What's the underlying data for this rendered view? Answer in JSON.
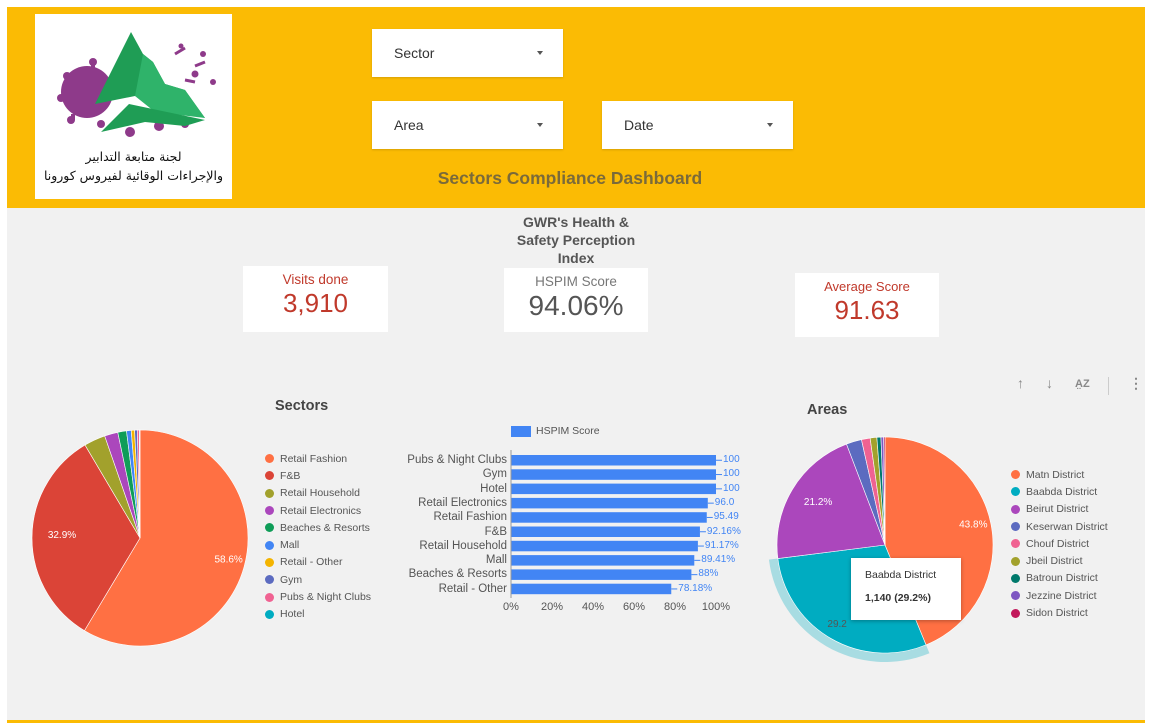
{
  "logo": {
    "line1": "لجنة متابعة التدابير",
    "line2": "والإجراءات الوقائية لفيروس كورونا"
  },
  "filters": {
    "sector": "Sector",
    "area": "Area",
    "date": "Date"
  },
  "dashboard_title": "Sectors Compliance Dashboard",
  "index_title_lines": [
    "GWR's Health &",
    "Safety Perception",
    "Index"
  ],
  "cards": {
    "visits": {
      "label": "Visits done",
      "value": "3,910"
    },
    "hspim": {
      "label": "HSPIM Score",
      "value": "94.06%"
    },
    "average": {
      "label": "Average Score",
      "value": "91.63"
    }
  },
  "colors": {
    "header": "#fbbb04",
    "card_red": "#c0392b",
    "bar": "#4285f4",
    "background": "#f1f1f1"
  },
  "chart_data": [
    {
      "type": "pie",
      "title": "Sectors",
      "labels": [
        "Retail Fashion",
        "F&B",
        "Retail Household",
        "Retail Electronics",
        "Beaches & Resorts",
        "Mall",
        "Retail - Other",
        "Gym",
        "Pubs & Night Clubs",
        "Hotel"
      ],
      "values": [
        58.6,
        32.9,
        3.2,
        2.0,
        1.3,
        0.7,
        0.5,
        0.4,
        0.3,
        0.1
      ],
      "value_labels": [
        "58.6%",
        "32.9%",
        "",
        "",
        "",
        "",
        "",
        "",
        "",
        ""
      ],
      "colors": [
        "#ff7043",
        "#db4437",
        "#a2a12c",
        "#ab47bc",
        "#0f9d58",
        "#4285f4",
        "#f4b400",
        "#5c6bc0",
        "#f06292",
        "#00acc1"
      ],
      "legend": "right"
    },
    {
      "type": "bar",
      "orientation": "horizontal",
      "series": [
        {
          "name": "HSPIM Score",
          "values": [
            100,
            100,
            100,
            96.0,
            95.49,
            92.16,
            91.17,
            89.41,
            88,
            78.18
          ]
        }
      ],
      "categories": [
        "Pubs & Night Clubs",
        "Gym",
        "Hotel",
        "Retail Electronics",
        "Retail Fashion",
        "F&B",
        "Retail Household",
        "Mall",
        "Beaches & Resorts",
        "Retail - Other"
      ],
      "value_labels": [
        "100",
        "100",
        "100",
        "96.0",
        "95.49",
        "92.16%",
        "91.17%",
        "89.41%",
        "88%",
        "78.18%"
      ],
      "x_ticks": [
        "0%",
        "20%",
        "40%",
        "60%",
        "80%",
        "100%"
      ],
      "xlim": [
        0,
        100
      ],
      "legend": "top"
    },
    {
      "type": "pie",
      "title": "Areas",
      "labels": [
        "Matn District",
        "Baabda District",
        "Beirut District",
        "Keserwan District",
        "Chouf District",
        "Jbeil District",
        "Batroun District",
        "Jezzine District",
        "Sidon District"
      ],
      "values": [
        43.8,
        29.2,
        21.2,
        2.3,
        1.3,
        1.0,
        0.6,
        0.4,
        0.2
      ],
      "value_labels": [
        "43.8%",
        "29.2",
        "21.2%",
        "",
        "",
        "",
        "",
        "",
        ""
      ],
      "colors": [
        "#ff7043",
        "#00acc1",
        "#ab47bc",
        "#5c6bc0",
        "#f06292",
        "#a2a12c",
        "#00796b",
        "#7e57c2",
        "#c2185b"
      ],
      "legend": "right",
      "tooltip": {
        "label": "Baabda District",
        "value": "1,140 (29.2%)"
      }
    }
  ]
}
